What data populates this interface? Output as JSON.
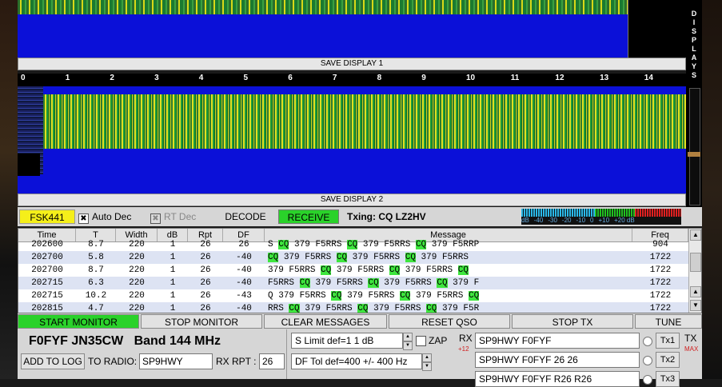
{
  "displays": {
    "save_display_1": "SAVE DISPLAY 1",
    "save_display_2": "SAVE DISPLAY 2",
    "side_label": [
      "D",
      "I",
      "S",
      "P",
      "L",
      "A",
      "Y",
      "S"
    ],
    "scale_ticks": [
      "0",
      "1",
      "2",
      "3",
      "4",
      "5",
      "6",
      "7",
      "8",
      "9",
      "10",
      "11",
      "12",
      "13",
      "14",
      "15"
    ]
  },
  "status": {
    "mode": "FSK441",
    "auto_dec_label": "Auto Dec",
    "rt_dec_label": "RT Dec",
    "decode_label": "DECODE",
    "receive_label": "RECEIVE",
    "txing": "Txing: CQ LZ2HV",
    "meter_labels": [
      "dB",
      "-40",
      "-30",
      "-20",
      "-10",
      "0",
      "+10",
      "+20 dB"
    ]
  },
  "table": {
    "headers": [
      "Time",
      "T",
      "Width",
      "dB",
      "Rpt",
      "DF",
      "Message",
      "Freq"
    ],
    "rows": [
      {
        "time": "202600",
        "t": "8.7",
        "width": "220",
        "db": "1",
        "rpt": "26",
        "df": "26",
        "msg": "S CQ 379 F5RRS CQ 379 F5RRS CQ 379 F5RRP",
        "freq": "904"
      },
      {
        "time": "202700",
        "t": "5.8",
        "width": "220",
        "db": "1",
        "rpt": "26",
        "df": "-40",
        "msg": "CQ 379 F5RRS CQ 379 F5RRS CQ 379 F5RRS",
        "freq": "1722"
      },
      {
        "time": "202700",
        "t": "8.7",
        "width": "220",
        "db": "1",
        "rpt": "26",
        "df": "-40",
        "msg": "379 F5RRS CQ 379 F5RRS CQ 379 F5RRS CQ",
        "freq": "1722"
      },
      {
        "time": "202715",
        "t": "6.3",
        "width": "220",
        "db": "1",
        "rpt": "26",
        "df": "-40",
        "msg": "F5RRS CQ 379 F5RRS CQ 379 F5RRS CQ 379 F",
        "freq": "1722"
      },
      {
        "time": "202715",
        "t": "10.2",
        "width": "220",
        "db": "1",
        "rpt": "26",
        "df": "-43",
        "msg": "Q 379 F5RRS CQ 379 F5RRS CQ 379 F5RRS CQ",
        "freq": "1722"
      },
      {
        "time": "202815",
        "t": "4.7",
        "width": "220",
        "db": "1",
        "rpt": "26",
        "df": "-40",
        "msg": "RRS CQ 379 F5RRS CQ 379 F5RRS CQ 379 F5R",
        "freq": "1722"
      }
    ]
  },
  "buttons": {
    "start_monitor": "START MONITOR",
    "stop_monitor": "STOP MONITOR",
    "clear_messages": "CLEAR MESSAGES",
    "reset_qso": "RESET QSO",
    "stop_tx": "STOP TX",
    "tune": "TUNE"
  },
  "station": {
    "info": "F0FYF JN35CW   Band 144 MHz",
    "add_to_log": "ADD TO LOG",
    "to_radio_label": "TO RADIO:",
    "to_radio_value": "SP9HWY",
    "rx_rpt_label": "RX RPT :",
    "rx_rpt_value": "26"
  },
  "controls": {
    "s_limit": "S Limit def=1  1  dB",
    "df_tol": "DF Tol def=400 +/-  400  Hz",
    "zap_label": "ZAP",
    "rx_label": "RX",
    "rx_gain": "+12",
    "tx_label": "TX",
    "tx_max": "MAX"
  },
  "tx_messages": [
    {
      "text": "SP9HWY F0FYF",
      "button": "Tx1"
    },
    {
      "text": "SP9HWY F0FYF 26 26",
      "button": "Tx2"
    },
    {
      "text": "SP9HWY F0FYF R26 R26",
      "button": "Tx3"
    }
  ],
  "colors": {
    "waterfall_bg": "#0b10d8",
    "active_green": "#2ad22a",
    "mode_yellow": "#f5ef1a",
    "cq_highlight": "#3ee63e"
  }
}
